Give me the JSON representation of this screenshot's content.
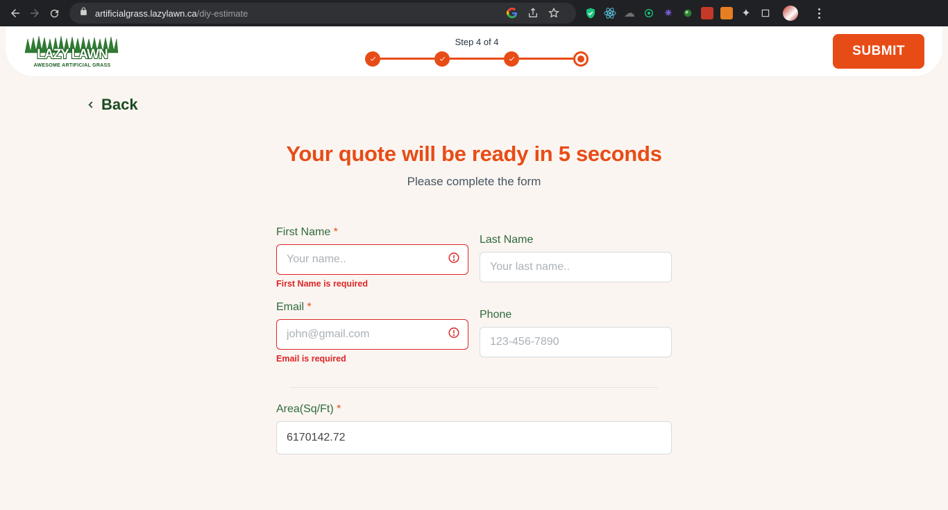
{
  "browser": {
    "url_host": "artificialgrass.lazylawn.ca",
    "url_path": "/diy-estimate"
  },
  "header": {
    "step_label": "Step 4 of 4",
    "submit": "SUBMIT",
    "logo_top": "LAZY LAWN",
    "logo_sub": "AWESOME ARTIFICIAL GRASS"
  },
  "back": {
    "label": "Back"
  },
  "main": {
    "heading": "Your quote will be ready in 5 seconds",
    "sub": "Please complete the form"
  },
  "form": {
    "firstName": {
      "label": "First Name ",
      "req": "*",
      "placeholder": "Your name..",
      "error": "First Name is required"
    },
    "lastName": {
      "label": "Last Name",
      "placeholder": "Your last name.."
    },
    "email": {
      "label": "Email ",
      "req": "*",
      "placeholder": "john@gmail.com",
      "error": "Email is required"
    },
    "phone": {
      "label": "Phone",
      "placeholder": "123-456-7890"
    },
    "area": {
      "label": "Area(Sq/Ft) ",
      "req": "*",
      "value": "6170142.72"
    }
  }
}
